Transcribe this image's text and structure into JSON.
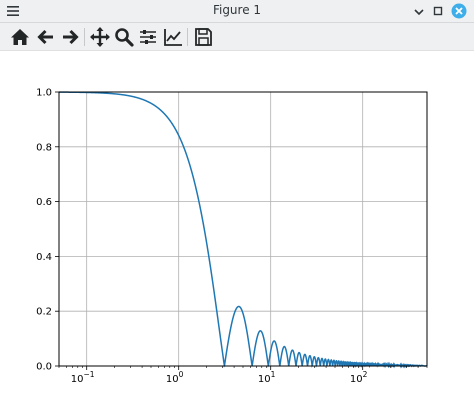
{
  "window": {
    "title": "Figure 1"
  },
  "toolbar": {
    "buttons": [
      "home-icon",
      "back-icon",
      "forward-icon",
      "pan-icon",
      "zoom-icon",
      "configure-subplots-icon",
      "edit-axis-icon",
      "save-icon"
    ]
  },
  "colors": {
    "line": "#1f77b4",
    "close_button": "#3daee9",
    "grid": "#b0b0b0"
  },
  "chart_data": {
    "type": "line",
    "title": "",
    "xlabel": "",
    "ylabel": "",
    "xscale": "log",
    "xlim": [
      0.05,
      500
    ],
    "ylim": [
      0.0,
      1.0
    ],
    "grid": true,
    "function": "|sin(x)/x|",
    "x_ticks": [
      {
        "value": 0.1,
        "base": "10",
        "exp": "−1"
      },
      {
        "value": 1,
        "base": "10",
        "exp": "0"
      },
      {
        "value": 10,
        "base": "10",
        "exp": "1"
      },
      {
        "value": 100,
        "base": "10",
        "exp": "2"
      }
    ],
    "y_ticks": [
      "0.0",
      "0.2",
      "0.4",
      "0.6",
      "0.8",
      "1.0"
    ],
    "y_tick_values": [
      0.0,
      0.2,
      0.4,
      0.6,
      0.8,
      1.0
    ],
    "series": [
      {
        "x": [
          0.05,
          0.1,
          0.2,
          0.3,
          0.5,
          0.7,
          1.0,
          1.3,
          1.6,
          2.0,
          2.4,
          2.8,
          3.14,
          3.5,
          4.0,
          4.49,
          5.0,
          5.6,
          6.28,
          7.0,
          7.73,
          8.5,
          9.42,
          10.5,
          10.9,
          12.0,
          12.57,
          14.07,
          15.71,
          17.22,
          18.85,
          22.0,
          25.13,
          31.4,
          40.0,
          62.8,
          100,
          200,
          500
        ],
        "y": [
          1.0,
          0.998,
          0.993,
          0.985,
          0.959,
          0.92,
          0.841,
          0.74,
          0.625,
          0.455,
          0.281,
          0.119,
          0.0,
          0.1,
          0.189,
          0.217,
          0.192,
          0.112,
          0.0,
          0.094,
          0.128,
          0.094,
          0.0,
          0.084,
          0.091,
          0.045,
          0.0,
          0.071,
          0.064,
          0.058,
          0.0,
          0.0,
          0.0,
          0.0,
          0.019,
          0.0,
          0.005,
          0.004,
          0.001
        ]
      }
    ]
  }
}
